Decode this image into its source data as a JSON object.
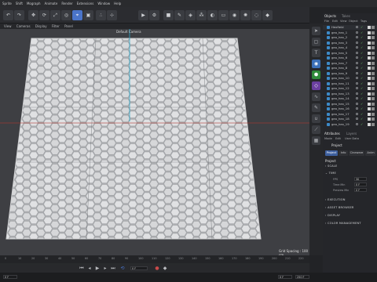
{
  "menubar": {
    "items": [
      "Sprite",
      "Shift",
      "Mograph",
      "Animate",
      "Render",
      "Extensions",
      "Window",
      "Help"
    ]
  },
  "viewport": {
    "menu": [
      "View",
      "Cameras",
      "Display",
      "Filter",
      "Panel"
    ],
    "camera_label": "Default Camera",
    "grid_spacing": "Grid Spacing : 100 cm"
  },
  "objects_panel": {
    "tabs": [
      "Objects",
      "Takes"
    ],
    "menu": [
      "File",
      "Edit",
      "View",
      "Object",
      "Tags"
    ],
    "items": [
      {
        "name": "Hexfield"
      },
      {
        "name": "geo_hex_1"
      },
      {
        "name": "geo_hex_2"
      },
      {
        "name": "geo_hex_3"
      },
      {
        "name": "geo_hex_4"
      },
      {
        "name": "geo_hex_5"
      },
      {
        "name": "geo_hex_6"
      },
      {
        "name": "geo_hex_7"
      },
      {
        "name": "geo_hex_8"
      },
      {
        "name": "geo_hex_9"
      },
      {
        "name": "geo_hex_10"
      },
      {
        "name": "geo_hex_11"
      },
      {
        "name": "geo_hex_12"
      },
      {
        "name": "geo_hex_13"
      },
      {
        "name": "geo_hex_14"
      },
      {
        "name": "geo_hex_15"
      },
      {
        "name": "geo_hex_16"
      },
      {
        "name": "geo_hex_17"
      },
      {
        "name": "geo_hex_18"
      },
      {
        "name": "geo_hex_19"
      }
    ]
  },
  "attributes_panel": {
    "tabs": [
      "Attributes",
      "Layers"
    ],
    "menu": [
      "Mode",
      "Edit",
      "User Data"
    ],
    "title": "Project",
    "mode_tabs": [
      "Project",
      "Info",
      "Cineware",
      "Anim"
    ],
    "section_title": "Project",
    "sections": [
      "SCALE",
      "TIME",
      "EXECUTION",
      "ASSET BROWSER",
      "DISPLAY",
      "COLOR MANAGEMENT"
    ],
    "time_fields": [
      {
        "label": "FPS",
        "value": "30"
      },
      {
        "label": "Time Min",
        "value": "0 F"
      },
      {
        "label": "Preview Min",
        "value": "0 F"
      }
    ]
  },
  "timeline": {
    "ticks": [
      "0",
      "10",
      "20",
      "30",
      "40",
      "50",
      "60",
      "70",
      "80",
      "90",
      "100",
      "110",
      "120",
      "130",
      "140",
      "150",
      "160",
      "170",
      "180",
      "190",
      "200",
      "210",
      "220"
    ]
  },
  "transport": {
    "current_frame": "0 F"
  },
  "status": {
    "left_frame": "0 F",
    "right_frame": "0 F",
    "frame_count": "250 F"
  },
  "colors": {
    "accent": "#4a74c9",
    "background": "#1e1f22",
    "viewport": "#3e3f43",
    "hex_tiles": "#d7d8da",
    "x_axis": "#c0392b",
    "y_axis": "#2aa7c9"
  }
}
